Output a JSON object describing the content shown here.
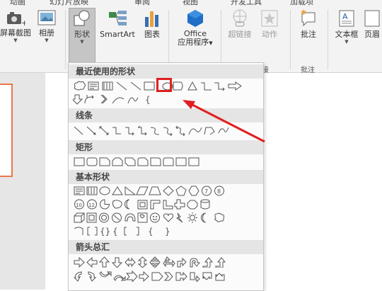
{
  "ribbon": {
    "top_tabs": [
      "动画",
      "幻灯片放映",
      "审阅",
      "视图",
      "开发工具",
      "加载项"
    ],
    "buttons": {
      "screenshot": "屏幕截图",
      "album": "相册",
      "shapes": "形状",
      "smartart": "SmartArt",
      "chart": "图表",
      "office_line1": "Office",
      "office_line2": "应用程序",
      "hyperlink": "超链接",
      "action": "动作",
      "comment": "批注",
      "textbox": "文本框",
      "header": "页眉"
    },
    "group_labels": {
      "links_tail": "接",
      "comments": "批注"
    }
  },
  "shapes_menu": {
    "sections": {
      "recent": "最近使用的形状",
      "lines": "线条",
      "rectangles": "矩形",
      "basic": "基本形状",
      "arrows": "箭头总汇"
    },
    "highlighted_shape": "oval-icon"
  },
  "colors": {
    "highlight": "#e02020",
    "accent": "#e8764a",
    "office_blue": "#1f6fc5"
  }
}
